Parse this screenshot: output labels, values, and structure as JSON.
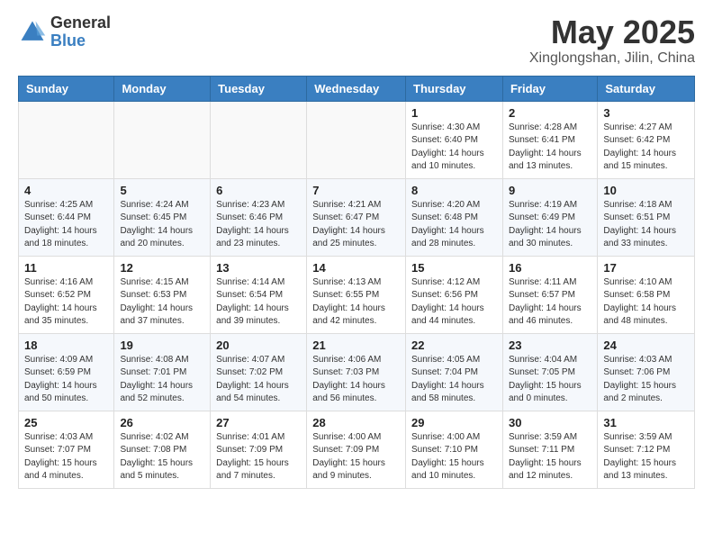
{
  "logo": {
    "general": "General",
    "blue": "Blue"
  },
  "title": {
    "month": "May 2025",
    "location": "Xinglongshan, Jilin, China"
  },
  "weekdays": [
    "Sunday",
    "Monday",
    "Tuesday",
    "Wednesday",
    "Thursday",
    "Friday",
    "Saturday"
  ],
  "weeks": [
    [
      {
        "day": "",
        "info": ""
      },
      {
        "day": "",
        "info": ""
      },
      {
        "day": "",
        "info": ""
      },
      {
        "day": "",
        "info": ""
      },
      {
        "day": "1",
        "info": "Sunrise: 4:30 AM\nSunset: 6:40 PM\nDaylight: 14 hours\nand 10 minutes."
      },
      {
        "day": "2",
        "info": "Sunrise: 4:28 AM\nSunset: 6:41 PM\nDaylight: 14 hours\nand 13 minutes."
      },
      {
        "day": "3",
        "info": "Sunrise: 4:27 AM\nSunset: 6:42 PM\nDaylight: 14 hours\nand 15 minutes."
      }
    ],
    [
      {
        "day": "4",
        "info": "Sunrise: 4:25 AM\nSunset: 6:44 PM\nDaylight: 14 hours\nand 18 minutes."
      },
      {
        "day": "5",
        "info": "Sunrise: 4:24 AM\nSunset: 6:45 PM\nDaylight: 14 hours\nand 20 minutes."
      },
      {
        "day": "6",
        "info": "Sunrise: 4:23 AM\nSunset: 6:46 PM\nDaylight: 14 hours\nand 23 minutes."
      },
      {
        "day": "7",
        "info": "Sunrise: 4:21 AM\nSunset: 6:47 PM\nDaylight: 14 hours\nand 25 minutes."
      },
      {
        "day": "8",
        "info": "Sunrise: 4:20 AM\nSunset: 6:48 PM\nDaylight: 14 hours\nand 28 minutes."
      },
      {
        "day": "9",
        "info": "Sunrise: 4:19 AM\nSunset: 6:49 PM\nDaylight: 14 hours\nand 30 minutes."
      },
      {
        "day": "10",
        "info": "Sunrise: 4:18 AM\nSunset: 6:51 PM\nDaylight: 14 hours\nand 33 minutes."
      }
    ],
    [
      {
        "day": "11",
        "info": "Sunrise: 4:16 AM\nSunset: 6:52 PM\nDaylight: 14 hours\nand 35 minutes."
      },
      {
        "day": "12",
        "info": "Sunrise: 4:15 AM\nSunset: 6:53 PM\nDaylight: 14 hours\nand 37 minutes."
      },
      {
        "day": "13",
        "info": "Sunrise: 4:14 AM\nSunset: 6:54 PM\nDaylight: 14 hours\nand 39 minutes."
      },
      {
        "day": "14",
        "info": "Sunrise: 4:13 AM\nSunset: 6:55 PM\nDaylight: 14 hours\nand 42 minutes."
      },
      {
        "day": "15",
        "info": "Sunrise: 4:12 AM\nSunset: 6:56 PM\nDaylight: 14 hours\nand 44 minutes."
      },
      {
        "day": "16",
        "info": "Sunrise: 4:11 AM\nSunset: 6:57 PM\nDaylight: 14 hours\nand 46 minutes."
      },
      {
        "day": "17",
        "info": "Sunrise: 4:10 AM\nSunset: 6:58 PM\nDaylight: 14 hours\nand 48 minutes."
      }
    ],
    [
      {
        "day": "18",
        "info": "Sunrise: 4:09 AM\nSunset: 6:59 PM\nDaylight: 14 hours\nand 50 minutes."
      },
      {
        "day": "19",
        "info": "Sunrise: 4:08 AM\nSunset: 7:01 PM\nDaylight: 14 hours\nand 52 minutes."
      },
      {
        "day": "20",
        "info": "Sunrise: 4:07 AM\nSunset: 7:02 PM\nDaylight: 14 hours\nand 54 minutes."
      },
      {
        "day": "21",
        "info": "Sunrise: 4:06 AM\nSunset: 7:03 PM\nDaylight: 14 hours\nand 56 minutes."
      },
      {
        "day": "22",
        "info": "Sunrise: 4:05 AM\nSunset: 7:04 PM\nDaylight: 14 hours\nand 58 minutes."
      },
      {
        "day": "23",
        "info": "Sunrise: 4:04 AM\nSunset: 7:05 PM\nDaylight: 15 hours\nand 0 minutes."
      },
      {
        "day": "24",
        "info": "Sunrise: 4:03 AM\nSunset: 7:06 PM\nDaylight: 15 hours\nand 2 minutes."
      }
    ],
    [
      {
        "day": "25",
        "info": "Sunrise: 4:03 AM\nSunset: 7:07 PM\nDaylight: 15 hours\nand 4 minutes."
      },
      {
        "day": "26",
        "info": "Sunrise: 4:02 AM\nSunset: 7:08 PM\nDaylight: 15 hours\nand 5 minutes."
      },
      {
        "day": "27",
        "info": "Sunrise: 4:01 AM\nSunset: 7:09 PM\nDaylight: 15 hours\nand 7 minutes."
      },
      {
        "day": "28",
        "info": "Sunrise: 4:00 AM\nSunset: 7:09 PM\nDaylight: 15 hours\nand 9 minutes."
      },
      {
        "day": "29",
        "info": "Sunrise: 4:00 AM\nSunset: 7:10 PM\nDaylight: 15 hours\nand 10 minutes."
      },
      {
        "day": "30",
        "info": "Sunrise: 3:59 AM\nSunset: 7:11 PM\nDaylight: 15 hours\nand 12 minutes."
      },
      {
        "day": "31",
        "info": "Sunrise: 3:59 AM\nSunset: 7:12 PM\nDaylight: 15 hours\nand 13 minutes."
      }
    ]
  ]
}
